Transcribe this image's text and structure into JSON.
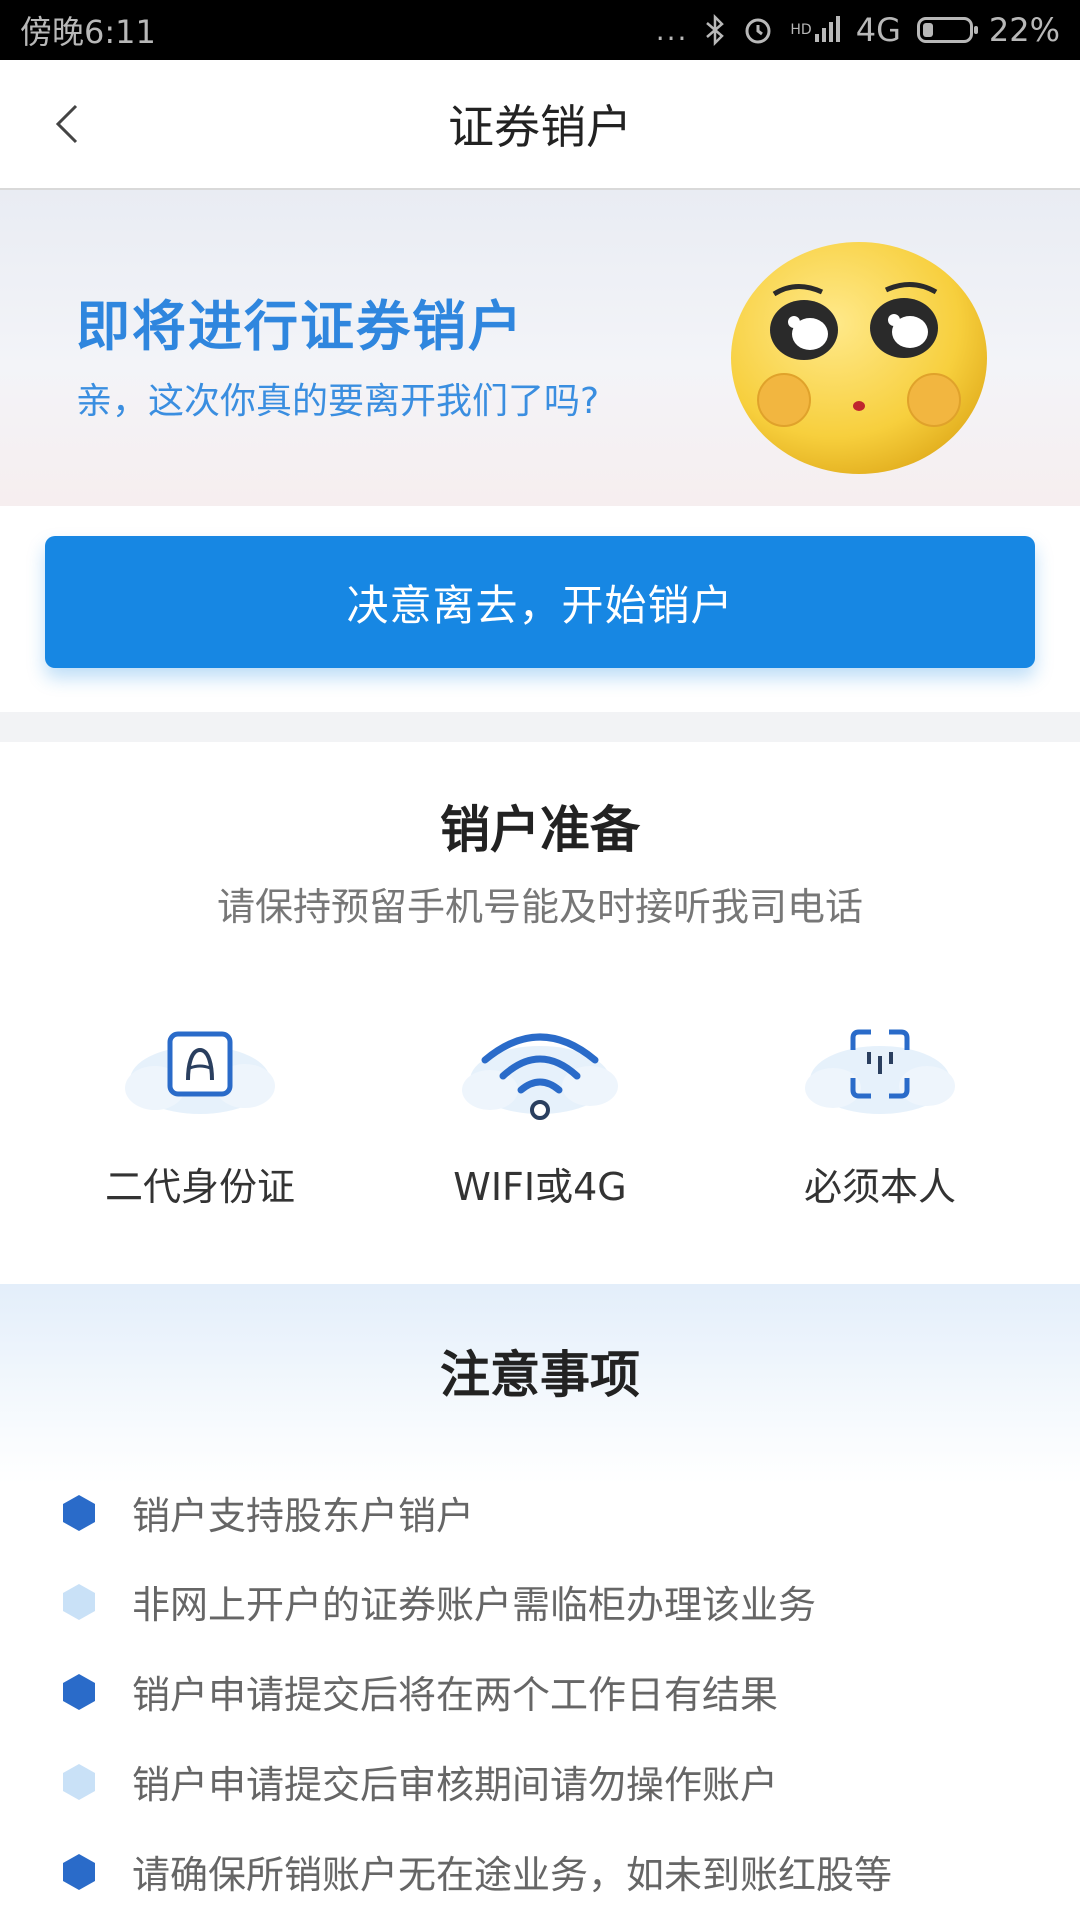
{
  "status_bar": {
    "time": "傍晚6:11",
    "dots": "...",
    "hd": "HD",
    "network": "4G",
    "battery": "22%"
  },
  "nav": {
    "title": "证券销户"
  },
  "banner": {
    "title": "即将进行证券销户",
    "subtitle": "亲，这次你真的要离开我们了吗?"
  },
  "primary_button": {
    "label": "决意离去，开始销户"
  },
  "prep": {
    "title": "销户准备",
    "subtitle": "请保持预留手机号能及时接听我司电话",
    "items": [
      {
        "label": "二代身份证",
        "icon": "id-card-icon"
      },
      {
        "label": "WIFI或4G",
        "icon": "wifi-icon"
      },
      {
        "label": "必须本人",
        "icon": "face-scan-icon"
      }
    ]
  },
  "notes": {
    "title": "注意事项",
    "items": [
      "销户支持股东户销户",
      "非网上开户的证券账户需临柜办理该业务",
      "销户申请提交后将在两个工作日有结果",
      "销户申请提交后审核期间请勿操作账户",
      "请确保所销账户无在途业务，如未到账红股等"
    ]
  },
  "colors": {
    "accent": "#1787e3",
    "banner_title": "#2f86de",
    "bullet_dark": "#2a6bc9",
    "bullet_light": "#c9e1f7"
  }
}
